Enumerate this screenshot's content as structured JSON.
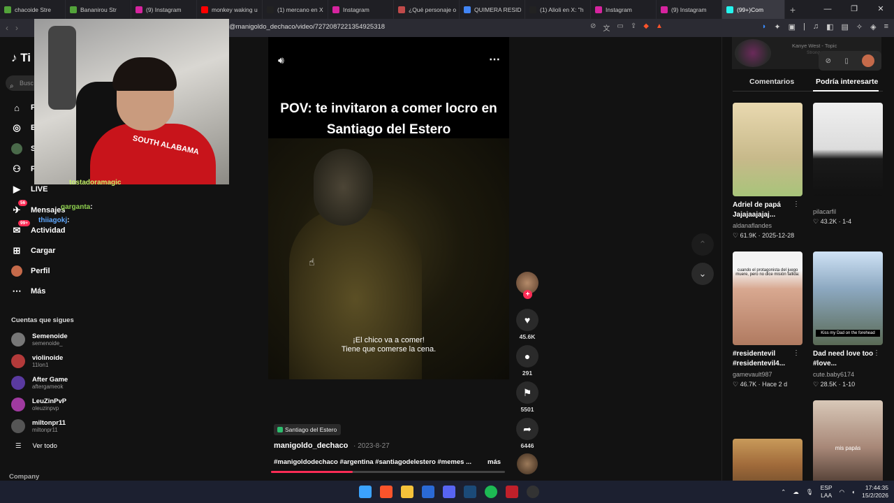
{
  "browser": {
    "tabs": [
      {
        "label": "chacoide Stre",
        "color": "#53a33a"
      },
      {
        "label": "Bananirou Str",
        "color": "#53a33a"
      },
      {
        "label": "(9) Instagram",
        "color": "#d6249f"
      },
      {
        "label": "monkey waking u",
        "color": "#ff0000"
      },
      {
        "label": "(1) mercano en X",
        "color": "#222222"
      },
      {
        "label": "Instagram",
        "color": "#d6249f"
      },
      {
        "label": "¿Qué personaje o",
        "color": "#c04a4a"
      },
      {
        "label": "QUIMERA RESID",
        "color": "#4285f4"
      },
      {
        "label": "(1) Alioli en X: \"h",
        "color": "#222222"
      },
      {
        "label": "Instagram",
        "color": "#d6249f"
      },
      {
        "label": "(9) Instagram",
        "color": "#d6249f"
      },
      {
        "label": "(99+)Com",
        "color": "#25f4ee"
      }
    ],
    "url": "@manigoldo_dechaco/video/7272087221354925318"
  },
  "sidebar": {
    "logo": "Ti",
    "search_placeholder": "Busc",
    "menu": [
      {
        "label": "P",
        "icon": "home-icon"
      },
      {
        "label": "E",
        "icon": "explore-icon"
      },
      {
        "label": "S",
        "icon": "avatar"
      },
      {
        "label": "F",
        "icon": "following-icon"
      },
      {
        "label": "LIVE",
        "icon": "live-icon"
      },
      {
        "label": "Mensajes",
        "icon": "messages-icon",
        "badge": "56"
      },
      {
        "label": "Actividad",
        "icon": "activity-icon",
        "badge": "99+"
      },
      {
        "label": "Cargar",
        "icon": "upload-icon"
      },
      {
        "label": "Perfil",
        "icon": "profile-icon"
      },
      {
        "label": "Más",
        "icon": "more-icon"
      }
    ],
    "following_title": "Cuentas que sigues",
    "following": [
      {
        "name": "Semenoide",
        "handle": "semenoide_",
        "color": "#777777"
      },
      {
        "name": "violinoide",
        "handle": "11lon1",
        "color": "#b33a3a"
      },
      {
        "name": "After Game",
        "handle": "aftergameok",
        "color": "#5a3aa0"
      },
      {
        "name": "LeuZinPvP",
        "handle": "oleuzinpvp",
        "color": "#a03aa0"
      },
      {
        "name": "miltonpr11",
        "handle": "miltonpr11",
        "color": "#555555"
      }
    ],
    "see_all": "Ver todo",
    "company": "Company"
  },
  "stream_overlay": {
    "chat": [
      {
        "user": "tostadoramagic",
        "color": "#c9f26a"
      },
      {
        "user": "garganta",
        "color": "#8fd14f"
      },
      {
        "user": "thiiagokj",
        "color": "#5fa8ff"
      }
    ]
  },
  "video": {
    "pov_text": "POV: te invitaron a comer locro en Santiago del Estero",
    "subtitle_line1": "¡El chico va a comer!",
    "subtitle_line2": "Tiene que comerse la cena.",
    "location": "Santiago del Estero",
    "author": "manigoldo_dechaco",
    "date": "2023-8-27",
    "hashtags": "#manigoldodechaco #argentina #santiagodelestero #memes ...",
    "more_label": "más",
    "progress": 0.35
  },
  "actions": {
    "likes": "45.6K",
    "comments": "291",
    "saves": "5501",
    "shares": "6446"
  },
  "right_panel": {
    "music_title": "Kanye West - Topic",
    "music_sub": "Stronger",
    "tabs": [
      "Comentarios",
      "Podría interesarte"
    ],
    "cards": [
      {
        "title": "Adriel de papá Jajajaajajaj...",
        "user": "aldanaflandes",
        "likes": "61.9K",
        "when": "2025-12-28",
        "thumb_caption": ""
      },
      {
        "title": "",
        "user": "pilacarfil",
        "likes": "43.2K",
        "when": "1-4",
        "thumb_caption": ""
      },
      {
        "title": "#residentevil #residentevil4...",
        "user": "gamevault987",
        "likes": "46.7K",
        "when": "Hace 2 d",
        "thumb_caption": "cuando el protagonista del juego muere, pero no dice misión fallida:"
      },
      {
        "title": "Dad need love too #love...",
        "user": "cute.baby6174",
        "likes": "28.5K",
        "when": "1-10",
        "thumb_caption": "Kiss my Dad on the forehead"
      },
      {
        "title": "",
        "user": "",
        "likes": "",
        "when": "",
        "thumb_caption": ""
      },
      {
        "title": "",
        "user": "",
        "likes": "",
        "when": "",
        "thumb_caption": "mis papás"
      }
    ]
  },
  "taskbar": {
    "lang1": "ESP",
    "lang2": "LAA",
    "time": "17:44:35",
    "date": "15/2/2026"
  }
}
